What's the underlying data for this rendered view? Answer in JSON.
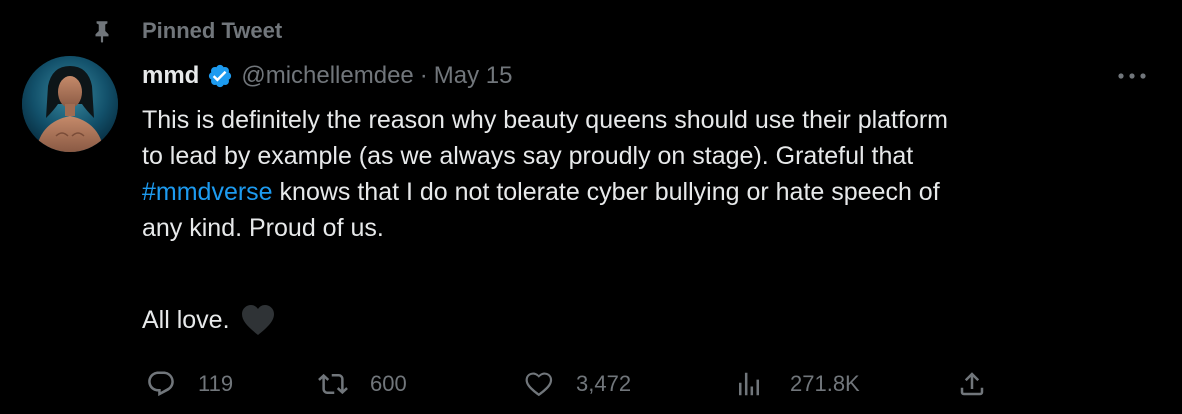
{
  "pinned": {
    "label": "Pinned Tweet",
    "icon": "pin-icon"
  },
  "author": {
    "display_name": "mmd",
    "verified": true,
    "handle": "@michellemdee",
    "separator": "·",
    "date": "May 15"
  },
  "tweet": {
    "lines": {
      "line1": "This is definitely the reason why beauty queens should use their platform",
      "line2": "to lead by example (as we always say proudly on stage). Grateful that",
      "line3_hashtag": "#mmdverse",
      "line3_rest": " knows that I do not tolerate cyber bullying or hate speech of",
      "line4": "any kind. Proud of us."
    },
    "closing": "All love.",
    "closing_emoji": "black-heart-emoji"
  },
  "actions": {
    "reply_count": "119",
    "retweet_count": "600",
    "like_count": "3,472",
    "views_count": "271.8K"
  },
  "colors": {
    "background": "#000000",
    "text": "#e7e9ea",
    "muted": "#71767b",
    "accent": "#1d9bf0"
  }
}
